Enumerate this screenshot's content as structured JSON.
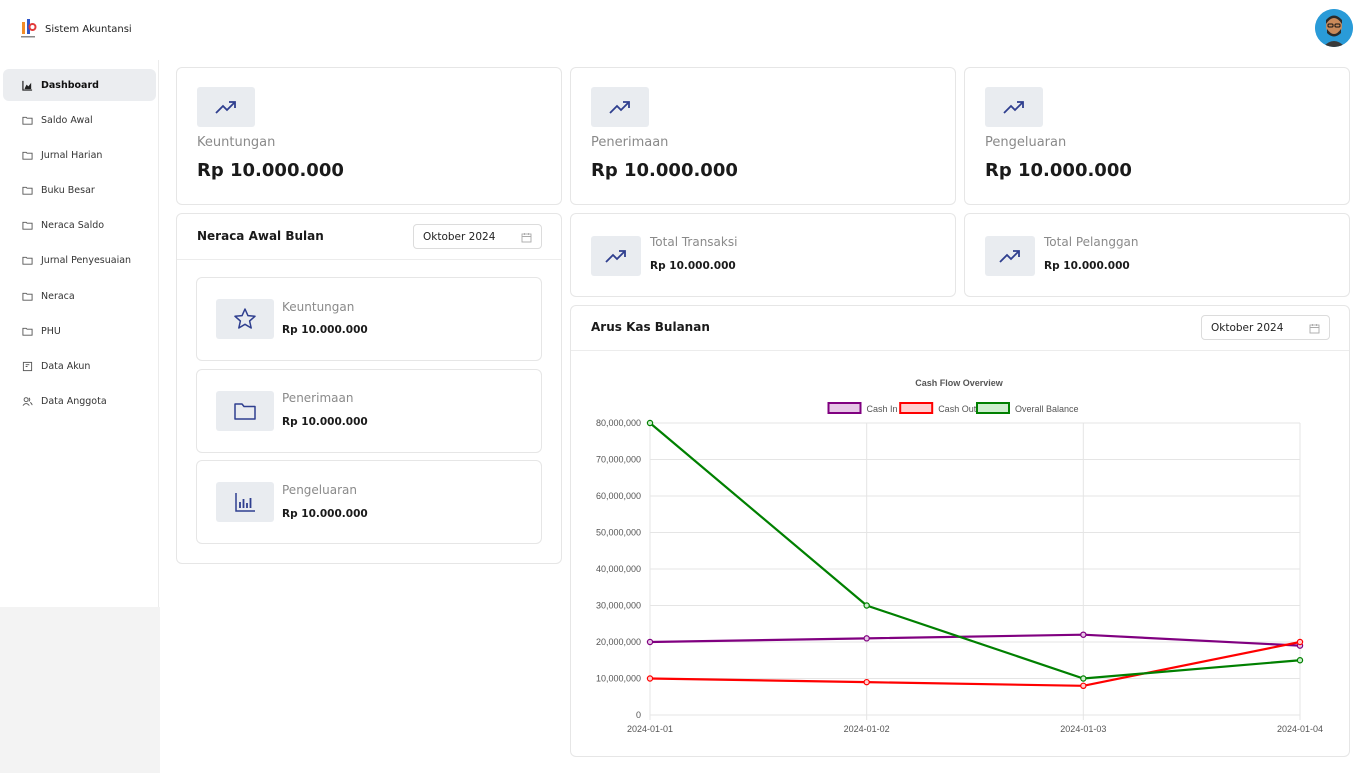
{
  "app": {
    "title": "Sistem Akuntansi"
  },
  "sidebar": {
    "items": [
      {
        "label": "Dashboard",
        "icon": "chart-area-icon",
        "active": true
      },
      {
        "label": "Saldo Awal",
        "icon": "folder-icon"
      },
      {
        "label": "Jurnal Harian",
        "icon": "folder-icon"
      },
      {
        "label": "Buku Besar",
        "icon": "folder-icon"
      },
      {
        "label": "Neraca Saldo",
        "icon": "folder-icon"
      },
      {
        "label": "Jurnal Penyesuaian",
        "icon": "folder-icon"
      },
      {
        "label": "Neraca",
        "icon": "folder-icon"
      },
      {
        "label": "PHU",
        "icon": "folder-icon"
      },
      {
        "label": "Data Akun",
        "icon": "wallet-icon"
      },
      {
        "label": "Data Anggota",
        "icon": "users-icon"
      }
    ]
  },
  "stats": [
    {
      "label": "Keuntungan",
      "value": "Rp 10.000.000",
      "icon": "trending-up-icon"
    },
    {
      "label": "Penerimaan",
      "value": "Rp 10.000.000",
      "icon": "trending-up-icon"
    },
    {
      "label": "Pengeluaran",
      "value": "Rp 10.000.000",
      "icon": "trending-up-icon"
    }
  ],
  "small_stats": [
    {
      "label": "Total Transaksi",
      "value": "Rp 10.000.000",
      "icon": "trending-up-icon"
    },
    {
      "label": "Total Pelanggan",
      "value": "Rp 10.000.000",
      "icon": "trending-up-icon"
    }
  ],
  "neraca": {
    "title": "Neraca Awal Bulan",
    "date": "Oktober 2024",
    "items": [
      {
        "label": "Keuntungan",
        "value": "Rp 10.000.000",
        "icon": "star-icon"
      },
      {
        "label": "Penerimaan",
        "value": "Rp 10.000.000",
        "icon": "folder-icon"
      },
      {
        "label": "Pengeluaran",
        "value": "Rp 10.000.000",
        "icon": "bar-chart-icon"
      }
    ]
  },
  "arus_kas": {
    "title": "Arus Kas Bulanan",
    "date": "Oktober 2024"
  },
  "colors": {
    "accent_icon": "#2f3f8f",
    "cash_in": "#800080",
    "cash_out": "#ff0000",
    "overall_balance": "#008000"
  },
  "chart_data": {
    "type": "line",
    "title": "Cash Flow Overview",
    "x": [
      "2024-01-01",
      "2024-01-02",
      "2024-01-03",
      "2024-01-04"
    ],
    "ylim": [
      0,
      80000000
    ],
    "yticks": [
      "0",
      "10,000,000",
      "20,000,000",
      "30,000,000",
      "40,000,000",
      "50,000,000",
      "60,000,000",
      "70,000,000",
      "80,000,000"
    ],
    "legend_position": "top",
    "grid": true,
    "series": [
      {
        "name": "Cash In",
        "values": [
          20000000,
          21000000,
          22000000,
          19000000
        ],
        "color": "#800080",
        "fill": "#e6c6e6"
      },
      {
        "name": "Cash Out",
        "values": [
          10000000,
          9000000,
          8000000,
          20000000
        ],
        "color": "#ff0000",
        "fill": "#ffd0d0"
      },
      {
        "name": "Overall Balance",
        "values": [
          80000000,
          30000000,
          10000000,
          15000000
        ],
        "color": "#008000",
        "fill": "#cdeecd"
      }
    ]
  }
}
